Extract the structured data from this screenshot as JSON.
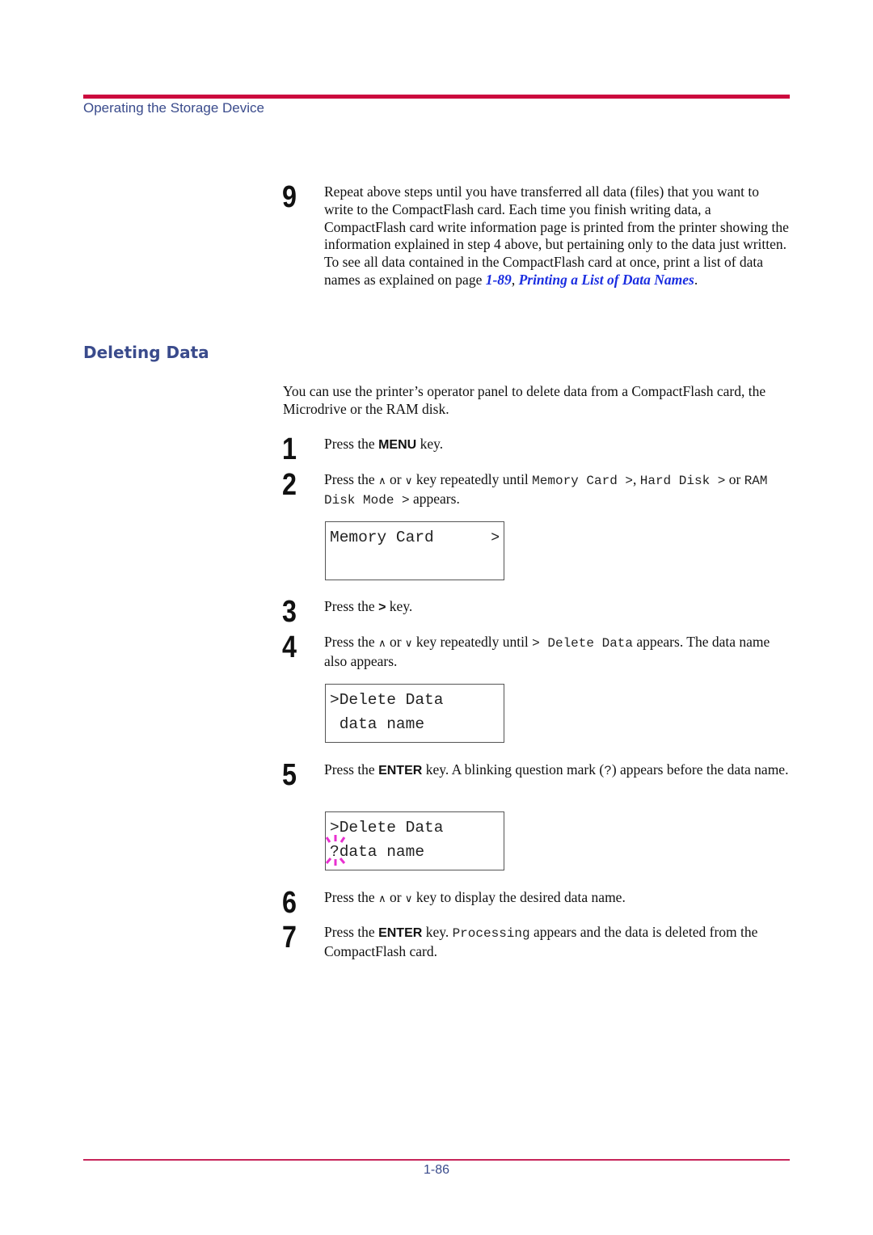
{
  "header": {
    "section_title": "Operating the Storage Device",
    "rule_color": "#cc0a3e"
  },
  "section": {
    "heading": "Deleting Data",
    "intro": "You can use the printer’s operator panel to delete data from a CompactFlash card, the Microdrive or the RAM disk."
  },
  "step9": {
    "number": "9",
    "text": "Repeat above steps until you have transferred all data (files) that you want to write to the CompactFlash card. Each time you finish writing data, a CompactFlash card write information page is printed from the printer showing the information explained in step 4 above, but pertaining only to the data just written. To see all data contained in the CompactFlash card at once, print a list of data names as explained on page ",
    "link_page": "1-89",
    "sep": ", ",
    "link_title": "Printing a List of Data Names",
    "end": "."
  },
  "steps": [
    {
      "number": "1",
      "pre": "Press the ",
      "key": "MENU",
      "post": " key."
    },
    {
      "number": "2",
      "pre": "Press the ",
      "up_icon": "∧",
      "or": " or ",
      "down_icon": "∨",
      "mid": " key repeatedly until ",
      "mono1": "Memory Card >",
      "sep1": ", ",
      "mono2": "Hard Disk >",
      "sep2": " or ",
      "mono3": "RAM Disk Mode >",
      "post": " appears."
    },
    {
      "number": "3",
      "pre": "Press the ",
      "key": ">",
      "post": " key."
    },
    {
      "number": "4",
      "pre": "Press the ",
      "up_icon": "∧",
      "or": " or ",
      "down_icon": "∨",
      "mid": " key repeatedly until ",
      "mono1": "> Delete Data",
      "post": " appears. The data name also appears."
    },
    {
      "number": "5",
      "pre": "Press the ",
      "key": "ENTER",
      "mid": " key. A blinking question mark (",
      "mono1": "?",
      "post": ") appears before the data name."
    },
    {
      "number": "6",
      "pre": "Press the ",
      "up_icon": "∧",
      "or": " or ",
      "down_icon": "∨",
      "post": " key to display the desired data name."
    },
    {
      "number": "7",
      "pre": "Press the ",
      "key": "ENTER",
      "mid": " key. ",
      "mono1": "Processing",
      "post": " appears and the data is deleted from the CompactFlash card."
    }
  ],
  "lcd_displays": [
    {
      "line1": "Memory Card",
      "arrow": ">",
      "line2": ""
    },
    {
      "line1": ">Delete Data",
      "line2": " data name"
    },
    {
      "line1": ">Delete Data",
      "line2": "?data name",
      "blink_color": "#e830d0"
    }
  ],
  "footer": {
    "page_number": "1-86"
  }
}
